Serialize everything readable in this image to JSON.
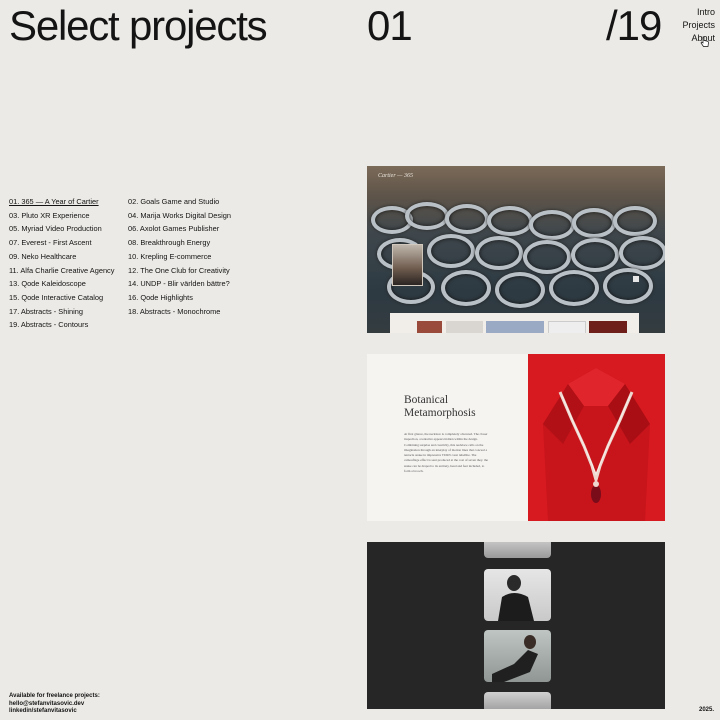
{
  "header": {
    "title": "Select projects",
    "current": "01",
    "total": "/19"
  },
  "nav": {
    "items": [
      "Intro",
      "Projects",
      "About"
    ]
  },
  "projects": {
    "col1": [
      "01. 365 — A Year of Cartier",
      "03. Pluto XR Experience",
      "05. Myriad Video Production",
      "07. Everest - First Ascent",
      "09. Neko Healthcare",
      "11. Alfa Charlie Creative Agency",
      "13. Qode Kaleidoscope",
      "15. Qode Interactive Catalog",
      "17. Abstracts - Shining",
      "19. Abstracts - Contours"
    ],
    "col2": [
      "02. Goals Game and Studio",
      "04. Marija Works Digital Design",
      "06. Axolot Games Publisher",
      "08. Breakthrough Energy",
      "10. Krepling E-commerce",
      "12. The One Club for Creativity",
      "14. UNDP - Blir världen bättre?",
      "16. Qode Highlights",
      "18. Abstracts - Monochrome"
    ],
    "active_index": 0
  },
  "cards": {
    "card1_label": "Cartier — 365",
    "card2_heading_line1": "Botanical",
    "card2_heading_line2": "Metamorphosis",
    "card2_body": "At first glance, the necklace is completely obscured. The closer inspection, a tentative appears hidden within the design. Combining surprise and creativity, this necklace calls on the imagination through an interplay of motion lines that conceal a tentacle snake in impressive TURN carat tubellite. The camouflage effect is sent produced at the cost of seven they. the snake can be draped to its entirety, head and feet included, to form a brooch."
  },
  "footer": {
    "line1": "Available for freelance projects:",
    "line2": "hello@stefanvitasovic.dev",
    "line3": "linkedin/stefanvitasovic",
    "year": "2025."
  },
  "colors": {
    "background": "#ebeae6",
    "text": "#141414",
    "accent_red": "#d71920"
  }
}
